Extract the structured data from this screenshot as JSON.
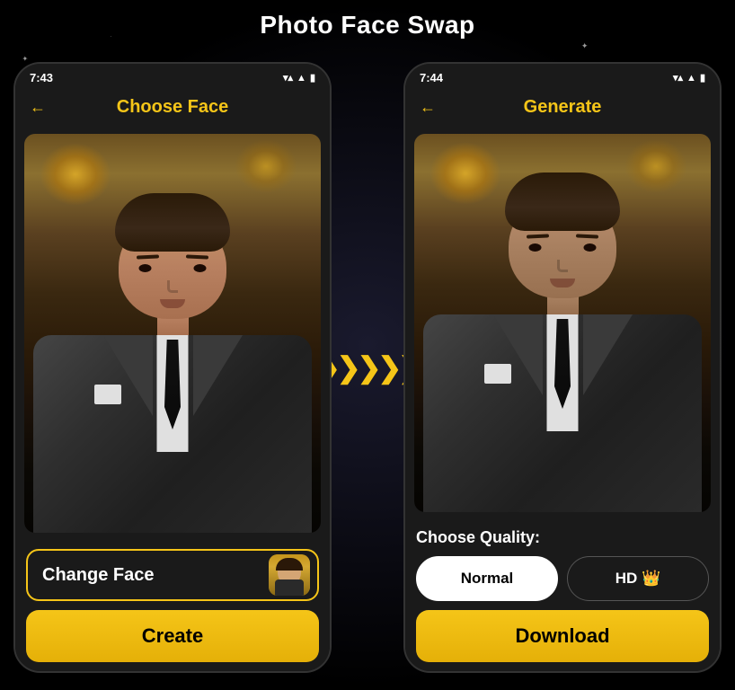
{
  "page": {
    "title": "Photo Face Swap",
    "background_color": "#000000"
  },
  "phone_left": {
    "status_bar": {
      "time": "7:43",
      "icons": [
        "signal",
        "wifi",
        "battery"
      ]
    },
    "header": {
      "title": "Choose Face",
      "back_label": "←"
    },
    "image_alt": "Man in suit portrait",
    "change_face_btn": "Change Face",
    "create_btn": "Create"
  },
  "phone_right": {
    "status_bar": {
      "time": "7:44",
      "icons": [
        "signal",
        "wifi",
        "battery"
      ]
    },
    "header": {
      "title": "Generate",
      "back_label": "←"
    },
    "image_alt": "Generated face swap result",
    "quality_label": "Choose Quality:",
    "quality_options": [
      {
        "id": "normal",
        "label": "Normal",
        "active": true
      },
      {
        "id": "hd",
        "label": "HD 👑",
        "active": false
      }
    ],
    "download_btn": "Download"
  },
  "arrows": {
    "symbol": "❯❯❯❯❯"
  }
}
